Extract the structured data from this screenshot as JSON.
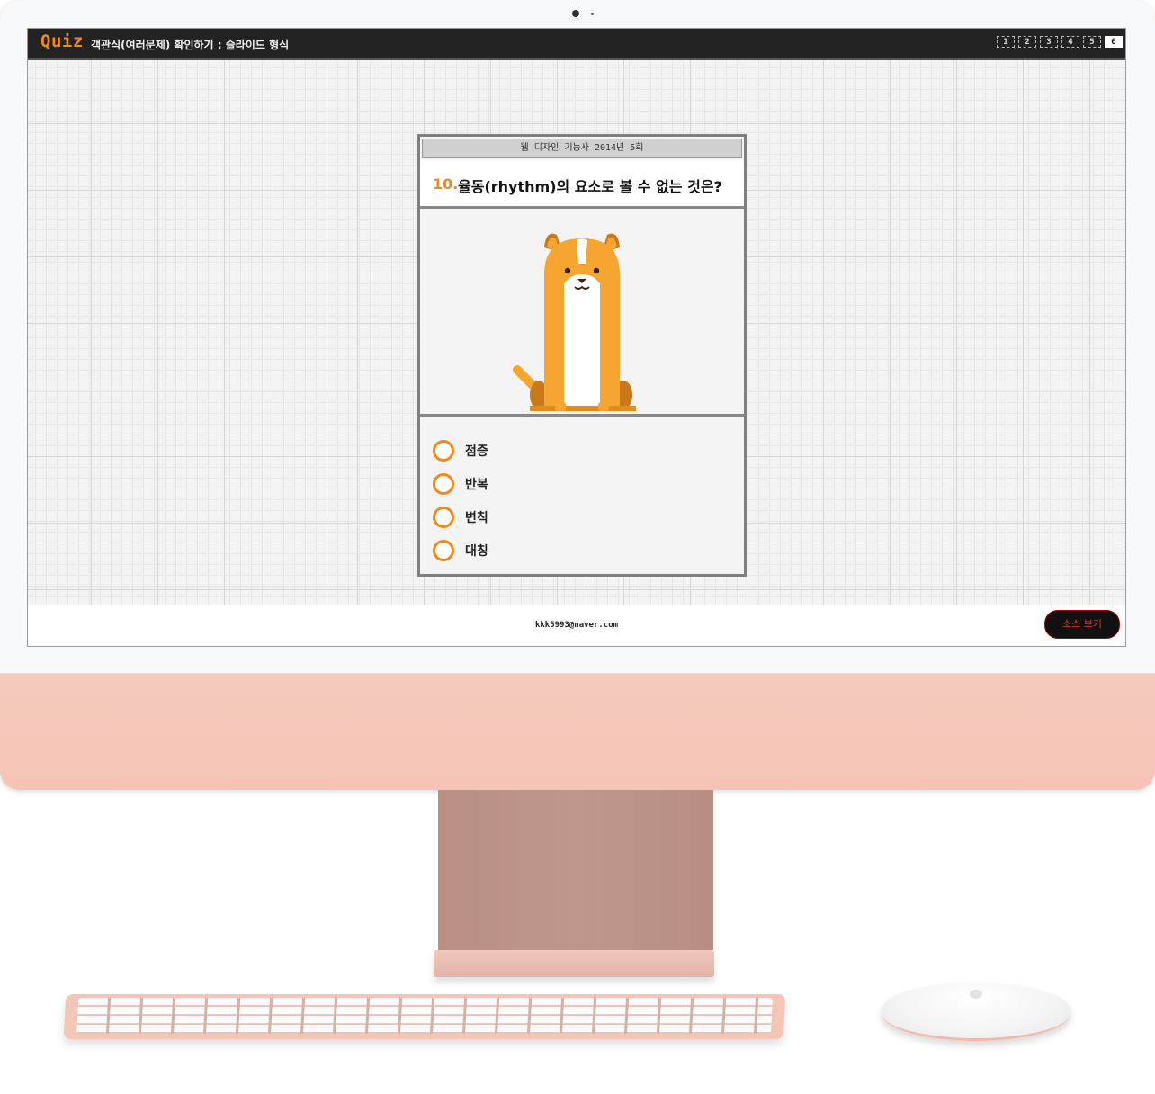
{
  "topbar": {
    "brand": "Quiz",
    "subtitle": "객관식(여러문제) 확인하기 : 슬라이드 형식",
    "pages": [
      "1",
      "2",
      "3",
      "4",
      "5",
      "6"
    ],
    "active_page": "6"
  },
  "quiz": {
    "source": "웹 디자인 기능사 2014년 5회",
    "number": "10.",
    "question": "율동(rhythm)의 요소로 볼 수 없는 것은?",
    "options": [
      "점증",
      "반복",
      "변칙",
      "대칭"
    ]
  },
  "footer": {
    "email": "kkk5993@naver.com",
    "source_button": "소스 보기"
  },
  "colors": {
    "accent": "#f08a1c",
    "dog": "#f6a630",
    "monitor": "#f7c9bb"
  },
  "icons": [
    "dog-illustration",
    "radio-icon"
  ]
}
